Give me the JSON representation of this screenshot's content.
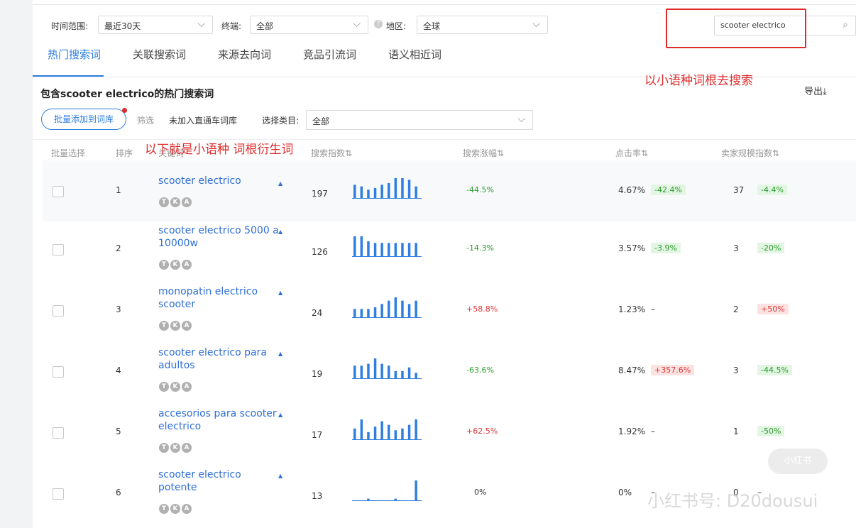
{
  "filters": {
    "time_label": "时间范围:",
    "time_value": "最近30天",
    "terminal_label": "终端:",
    "terminal_value": "全部",
    "region_label": "地区:",
    "region_value": "全球"
  },
  "search": {
    "value": "scooter electrico"
  },
  "tabs": [
    {
      "label": "热门搜索词",
      "active": true
    },
    {
      "label": "关联搜索词"
    },
    {
      "label": "来源去向词"
    },
    {
      "label": "竞品引流词"
    },
    {
      "label": "语义相近词"
    }
  ],
  "annotations": {
    "search_note": "以小语种词根去搜索",
    "table_note": "以下就是小语种 词根衍生词"
  },
  "export_label": "导出",
  "section_title": "包含scooter electrico的热门搜索词",
  "toolbar": {
    "bulk_add": "批量添加到词库",
    "filter": "筛选",
    "not_added": "未加入直通车词库",
    "category_label": "选择类目:",
    "category_value": "全部"
  },
  "table": {
    "headers": [
      "批量选择",
      "排序",
      "关键词",
      "搜索指数",
      "搜索涨幅",
      "点击率",
      "卖家规模指数"
    ],
    "tag_letters": [
      "T",
      "K",
      "A"
    ],
    "rows": [
      {
        "rank": "1",
        "keyword": "scooter electrico",
        "search_index": "197",
        "spark": [
          8,
          7,
          5,
          6,
          8,
          9,
          12,
          12,
          11,
          7
        ],
        "growth": "-44.5%",
        "ctr": "4.67%",
        "ctr_change": "-42.4%",
        "seller": "37",
        "seller_change": "-4.4%"
      },
      {
        "rank": "2",
        "keyword": "scooter electrico 5000 a 10000w",
        "search_index": "126",
        "spark": [
          12,
          12,
          9,
          8,
          8,
          8,
          8,
          8,
          8,
          8
        ],
        "growth": "-14.3%",
        "ctr": "3.57%",
        "ctr_change": "-3.9%",
        "seller": "3",
        "seller_change": "-20%"
      },
      {
        "rank": "3",
        "keyword": "monopatin electrico scooter",
        "search_index": "24",
        "spark": [
          5,
          5,
          5,
          6,
          8,
          10,
          12,
          10,
          8,
          10
        ],
        "growth": "+58.8%",
        "ctr": "1.23%",
        "ctr_change": "–",
        "seller": "2",
        "seller_change": "+50%"
      },
      {
        "rank": "4",
        "keyword": "scooter electrico para adultos",
        "search_index": "19",
        "spark": [
          7,
          7,
          8,
          11,
          8,
          7,
          4,
          4,
          6,
          3
        ],
        "growth": "-63.6%",
        "ctr": "8.47%",
        "ctr_change": "+357.6%",
        "seller": "3",
        "seller_change": "-44.5%"
      },
      {
        "rank": "5",
        "keyword": "accesorios para scooter electrico",
        "search_index": "17",
        "spark": [
          6,
          11,
          4,
          7,
          10,
          8,
          5,
          6,
          8,
          11
        ],
        "growth": "+62.5%",
        "ctr": "1.92%",
        "ctr_change": "–",
        "seller": "1",
        "seller_change": "-50%"
      },
      {
        "rank": "6",
        "keyword": "scooter electrico potente",
        "search_index": "13",
        "spark": [
          0,
          0,
          1,
          0,
          0,
          0,
          1,
          0,
          0,
          12
        ],
        "growth": "0%",
        "ctr": "0%",
        "ctr_change": "–",
        "seller": "0",
        "seller_change": "–"
      }
    ]
  },
  "watermark": {
    "text": "小红书号: D20dousui",
    "logo": "小红书"
  },
  "colors": {
    "accent": "#2f7ee0",
    "annotation": "#e02b2b",
    "green": "#2a9a2a",
    "red": "#d33"
  }
}
